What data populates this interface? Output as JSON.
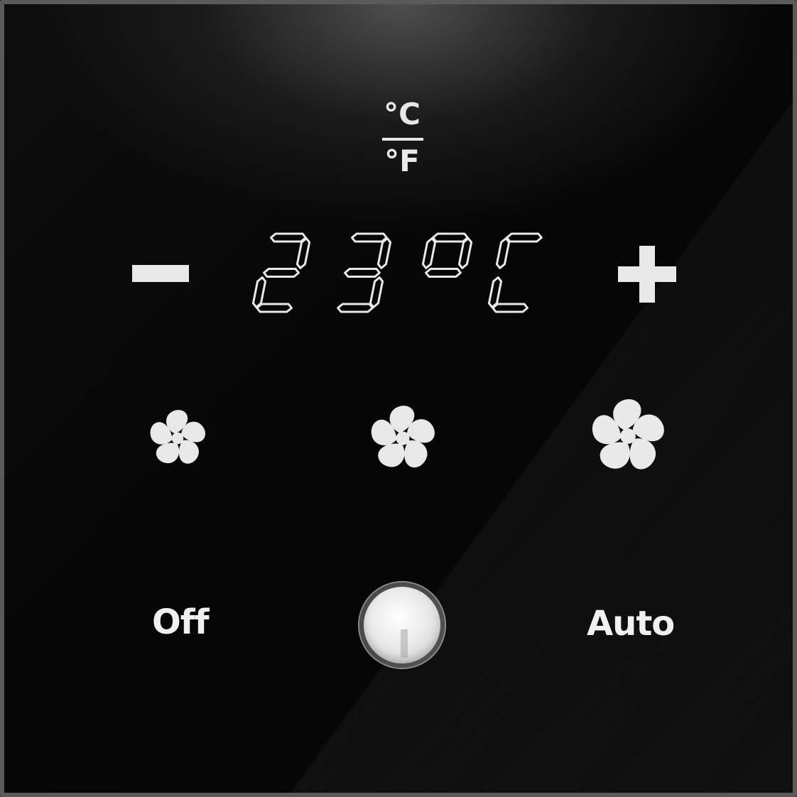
{
  "units": {
    "top": "°C",
    "bottom": "°F"
  },
  "display": {
    "temperature": "23",
    "unit": "°C"
  },
  "controls": {
    "decrease_icon": "minus-icon",
    "increase_icon": "plus-icon",
    "fan_speeds": [
      "fan-low-icon",
      "fan-medium-icon",
      "fan-high-icon"
    ]
  },
  "modes": {
    "off_label": "Off",
    "auto_label": "Auto"
  },
  "colors": {
    "panel": "#050505",
    "foreground": "#e8e8e8",
    "bezel": "#5a5a5a"
  }
}
